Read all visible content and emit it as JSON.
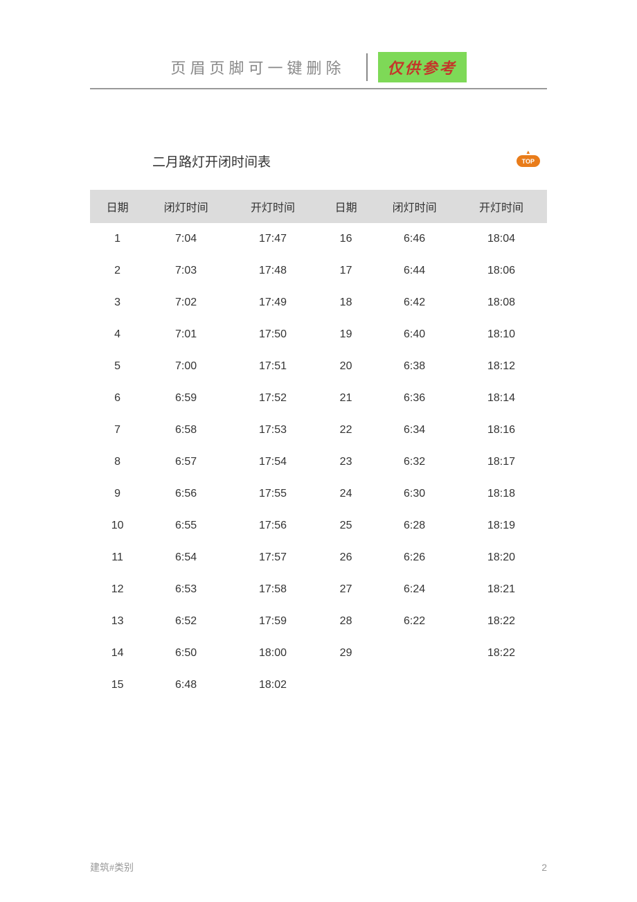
{
  "header": {
    "left_text": "页眉页脚可一键删除",
    "right_text": "仅供参考"
  },
  "title": "二月路灯开闭时间表",
  "top_badge": "TOP",
  "table": {
    "headers": [
      "日期",
      "闭灯时间",
      "开灯时间",
      "日期",
      "闭灯时间",
      "开灯时间"
    ],
    "rows": [
      [
        "1",
        "7:04",
        "17:47",
        "16",
        "6:46",
        "18:04"
      ],
      [
        "2",
        "7:03",
        "17:48",
        "17",
        "6:44",
        "18:06"
      ],
      [
        "3",
        "7:02",
        "17:49",
        "18",
        "6:42",
        "18:08"
      ],
      [
        "4",
        "7:01",
        "17:50",
        "19",
        "6:40",
        "18:10"
      ],
      [
        "5",
        "7:00",
        "17:51",
        "20",
        "6:38",
        "18:12"
      ],
      [
        "6",
        "6:59",
        "17:52",
        "21",
        "6:36",
        "18:14"
      ],
      [
        "7",
        "6:58",
        "17:53",
        "22",
        "6:34",
        "18:16"
      ],
      [
        "8",
        "6:57",
        "17:54",
        "23",
        "6:32",
        "18:17"
      ],
      [
        "9",
        "6:56",
        "17:55",
        "24",
        "6:30",
        "18:18"
      ],
      [
        "10",
        "6:55",
        "17:56",
        "25",
        "6:28",
        "18:19"
      ],
      [
        "11",
        "6:54",
        "17:57",
        "26",
        "6:26",
        "18:20"
      ],
      [
        "12",
        "6:53",
        "17:58",
        "27",
        "6:24",
        "18:21"
      ],
      [
        "13",
        "6:52",
        "17:59",
        "28",
        "6:22",
        "18:22"
      ],
      [
        "14",
        "6:50",
        "18:00",
        "29",
        "",
        "18:22"
      ],
      [
        "15",
        "6:48",
        "18:02",
        "",
        "",
        ""
      ]
    ]
  },
  "footer": {
    "left_text": "建筑#类别",
    "page_number": "2"
  }
}
